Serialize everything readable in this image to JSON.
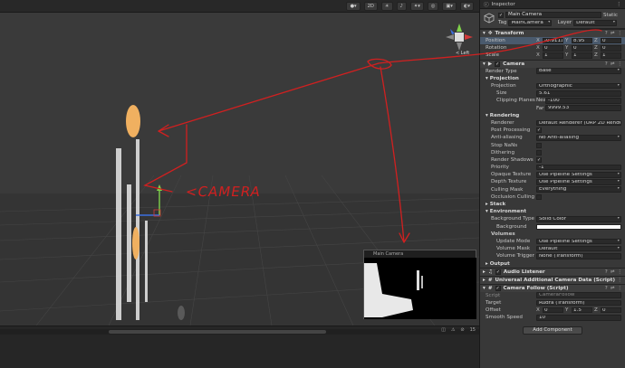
{
  "scene": {
    "toolbar_zoom": "2D",
    "gizmo_label": "< Left",
    "status_count": "15",
    "annotation": "<CAMERA",
    "camera_preview_title": "Main Camera"
  },
  "inspector": {
    "tab": "Inspector",
    "object_name": "Main Camera",
    "static_label": "Static",
    "tag_label": "Tag",
    "tag_value": "MainCamera",
    "layer_label": "Layer",
    "layer_value": "Default",
    "transform": {
      "title": "Transform",
      "position_label": "Position",
      "position": {
        "x": "-0.911103-",
        "y": "8.95",
        "z": "0"
      },
      "rotation_label": "Rotation",
      "rotation": {
        "x": "0",
        "y": "0",
        "z": "0"
      },
      "scale_label": "Scale",
      "scale": {
        "x": "1",
        "y": "1",
        "z": "1"
      }
    },
    "camera": {
      "title": "Camera",
      "render_type_label": "Render Type",
      "render_type": "Base",
      "projection_section": "Projection",
      "projection_label": "Projection",
      "projection": "Orthographic",
      "size_label": "Size",
      "size": "5.61",
      "clipping_label": "Clipping Planes",
      "near_label": "Near",
      "near": "-100",
      "far_label": "Far",
      "far": "9999.53",
      "rendering_section": "Rendering",
      "renderer_label": "Renderer",
      "renderer": "Default Renderer (URP 2D Renderer D",
      "post_label": "Post Processing",
      "aa_label": "Anti-aliasing",
      "aa": "No Anti-aliasing",
      "stop_nans_label": "Stop NaNs",
      "dithering_label": "Dithering",
      "shadows_label": "Render Shadows",
      "priority_label": "Priority",
      "priority": "-1",
      "opaque_label": "Opaque Texture",
      "opaque": "Use Pipeline Settings",
      "depth_label": "Depth Texture",
      "depth": "Use Pipeline Settings",
      "culling_label": "Culling Mask",
      "culling": "Everything",
      "occlusion_label": "Occlusion Culling",
      "stack_section": "Stack",
      "env_section": "Environment",
      "bg_type_label": "Background Type",
      "bg_type": "Solid Color",
      "background_label": "Background",
      "volumes_label": "Volumes",
      "update_mode_label": "Update Mode",
      "update_mode": "Use Pipeline Settings",
      "volume_mask_label": "Volume Mask",
      "volume_mask": "Default",
      "volume_trigger_label": "Volume Trigger",
      "volume_trigger": "None (Transform)",
      "output_section": "Output"
    },
    "audio_listener": "Audio Listener",
    "urp_data": "Universal Additional Camera Data (Script)",
    "camera_follow": {
      "title": "Camera Follow (Script)",
      "script_label": "Script",
      "script": "CameraFollow",
      "target_label": "Target",
      "target": "Rudra (Transform)",
      "offset_label": "Offset",
      "offset": {
        "x": "0",
        "y": "1.5",
        "z": "0"
      },
      "smooth_label": "Smooth Speed",
      "smooth": "10"
    },
    "add_component": "Add Component"
  },
  "colors": {
    "annotation_red": "#d12020",
    "scene_bg": "#333333",
    "inspector_bg": "#383838"
  }
}
